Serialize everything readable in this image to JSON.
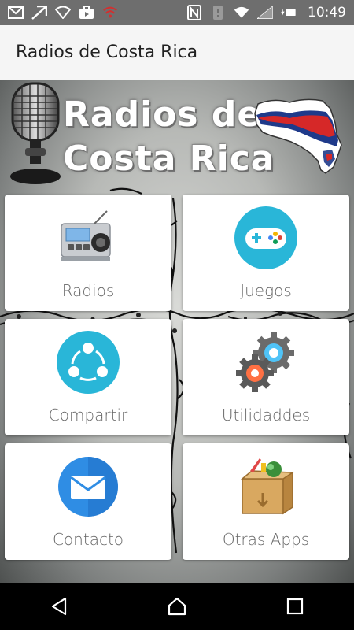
{
  "status_bar": {
    "time": "10:49",
    "icons": [
      "gmail-icon",
      "notification-arrow-icon",
      "wifi-outline-icon",
      "briefcase-icon",
      "wifi-alert-icon",
      "nfc-icon",
      "vibrate-icon",
      "wifi-icon",
      "signal-icon",
      "battery-charging-icon"
    ]
  },
  "app_bar": {
    "title": "Radios de Costa Rica"
  },
  "banner": {
    "line1": "Radios de",
    "line2": "Costa Rica"
  },
  "tiles": [
    {
      "label": "Radios",
      "icon": "radio-icon"
    },
    {
      "label": "Juegos",
      "icon": "gamepad-icon"
    },
    {
      "label": "Compartir",
      "icon": "share-icon"
    },
    {
      "label": "Utilidaddes",
      "icon": "gears-icon"
    },
    {
      "label": "Contacto",
      "icon": "mail-icon"
    },
    {
      "label": "Otras Apps",
      "icon": "box-icon"
    }
  ],
  "nav": {
    "icons": [
      "back-icon",
      "home-icon",
      "recents-icon"
    ]
  },
  "colors": {
    "status_bar": "#6e6e6e",
    "app_bar": "#f5f5f5",
    "tile_bg": "#ffffff",
    "label": "#666666",
    "accent_cyan": "#29b6d8"
  }
}
